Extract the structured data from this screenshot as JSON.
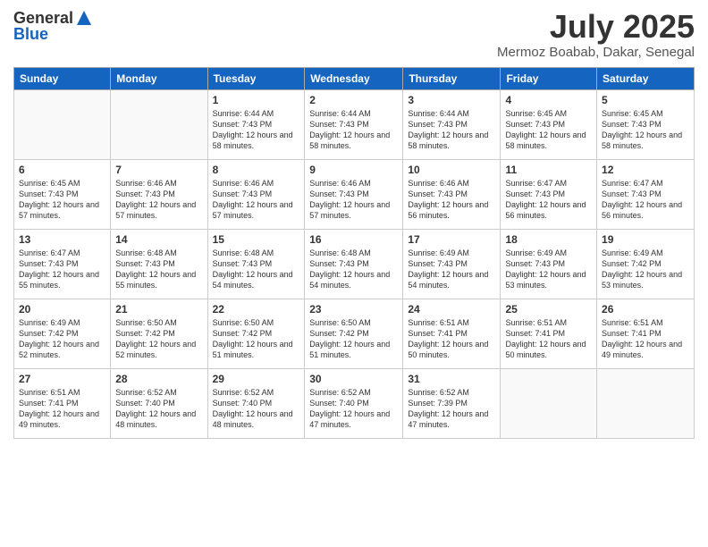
{
  "header": {
    "logo_line1": "General",
    "logo_line2": "Blue",
    "month": "July 2025",
    "location": "Mermoz Boabab, Dakar, Senegal"
  },
  "weekdays": [
    "Sunday",
    "Monday",
    "Tuesday",
    "Wednesday",
    "Thursday",
    "Friday",
    "Saturday"
  ],
  "weeks": [
    [
      {
        "day": "",
        "info": ""
      },
      {
        "day": "",
        "info": ""
      },
      {
        "day": "1",
        "info": "Sunrise: 6:44 AM\nSunset: 7:43 PM\nDaylight: 12 hours and 58 minutes."
      },
      {
        "day": "2",
        "info": "Sunrise: 6:44 AM\nSunset: 7:43 PM\nDaylight: 12 hours and 58 minutes."
      },
      {
        "day": "3",
        "info": "Sunrise: 6:44 AM\nSunset: 7:43 PM\nDaylight: 12 hours and 58 minutes."
      },
      {
        "day": "4",
        "info": "Sunrise: 6:45 AM\nSunset: 7:43 PM\nDaylight: 12 hours and 58 minutes."
      },
      {
        "day": "5",
        "info": "Sunrise: 6:45 AM\nSunset: 7:43 PM\nDaylight: 12 hours and 58 minutes."
      }
    ],
    [
      {
        "day": "6",
        "info": "Sunrise: 6:45 AM\nSunset: 7:43 PM\nDaylight: 12 hours and 57 minutes."
      },
      {
        "day": "7",
        "info": "Sunrise: 6:46 AM\nSunset: 7:43 PM\nDaylight: 12 hours and 57 minutes."
      },
      {
        "day": "8",
        "info": "Sunrise: 6:46 AM\nSunset: 7:43 PM\nDaylight: 12 hours and 57 minutes."
      },
      {
        "day": "9",
        "info": "Sunrise: 6:46 AM\nSunset: 7:43 PM\nDaylight: 12 hours and 57 minutes."
      },
      {
        "day": "10",
        "info": "Sunrise: 6:46 AM\nSunset: 7:43 PM\nDaylight: 12 hours and 56 minutes."
      },
      {
        "day": "11",
        "info": "Sunrise: 6:47 AM\nSunset: 7:43 PM\nDaylight: 12 hours and 56 minutes."
      },
      {
        "day": "12",
        "info": "Sunrise: 6:47 AM\nSunset: 7:43 PM\nDaylight: 12 hours and 56 minutes."
      }
    ],
    [
      {
        "day": "13",
        "info": "Sunrise: 6:47 AM\nSunset: 7:43 PM\nDaylight: 12 hours and 55 minutes."
      },
      {
        "day": "14",
        "info": "Sunrise: 6:48 AM\nSunset: 7:43 PM\nDaylight: 12 hours and 55 minutes."
      },
      {
        "day": "15",
        "info": "Sunrise: 6:48 AM\nSunset: 7:43 PM\nDaylight: 12 hours and 54 minutes."
      },
      {
        "day": "16",
        "info": "Sunrise: 6:48 AM\nSunset: 7:43 PM\nDaylight: 12 hours and 54 minutes."
      },
      {
        "day": "17",
        "info": "Sunrise: 6:49 AM\nSunset: 7:43 PM\nDaylight: 12 hours and 54 minutes."
      },
      {
        "day": "18",
        "info": "Sunrise: 6:49 AM\nSunset: 7:43 PM\nDaylight: 12 hours and 53 minutes."
      },
      {
        "day": "19",
        "info": "Sunrise: 6:49 AM\nSunset: 7:42 PM\nDaylight: 12 hours and 53 minutes."
      }
    ],
    [
      {
        "day": "20",
        "info": "Sunrise: 6:49 AM\nSunset: 7:42 PM\nDaylight: 12 hours and 52 minutes."
      },
      {
        "day": "21",
        "info": "Sunrise: 6:50 AM\nSunset: 7:42 PM\nDaylight: 12 hours and 52 minutes."
      },
      {
        "day": "22",
        "info": "Sunrise: 6:50 AM\nSunset: 7:42 PM\nDaylight: 12 hours and 51 minutes."
      },
      {
        "day": "23",
        "info": "Sunrise: 6:50 AM\nSunset: 7:42 PM\nDaylight: 12 hours and 51 minutes."
      },
      {
        "day": "24",
        "info": "Sunrise: 6:51 AM\nSunset: 7:41 PM\nDaylight: 12 hours and 50 minutes."
      },
      {
        "day": "25",
        "info": "Sunrise: 6:51 AM\nSunset: 7:41 PM\nDaylight: 12 hours and 50 minutes."
      },
      {
        "day": "26",
        "info": "Sunrise: 6:51 AM\nSunset: 7:41 PM\nDaylight: 12 hours and 49 minutes."
      }
    ],
    [
      {
        "day": "27",
        "info": "Sunrise: 6:51 AM\nSunset: 7:41 PM\nDaylight: 12 hours and 49 minutes."
      },
      {
        "day": "28",
        "info": "Sunrise: 6:52 AM\nSunset: 7:40 PM\nDaylight: 12 hours and 48 minutes."
      },
      {
        "day": "29",
        "info": "Sunrise: 6:52 AM\nSunset: 7:40 PM\nDaylight: 12 hours and 48 minutes."
      },
      {
        "day": "30",
        "info": "Sunrise: 6:52 AM\nSunset: 7:40 PM\nDaylight: 12 hours and 47 minutes."
      },
      {
        "day": "31",
        "info": "Sunrise: 6:52 AM\nSunset: 7:39 PM\nDaylight: 12 hours and 47 minutes."
      },
      {
        "day": "",
        "info": ""
      },
      {
        "day": "",
        "info": ""
      }
    ]
  ]
}
